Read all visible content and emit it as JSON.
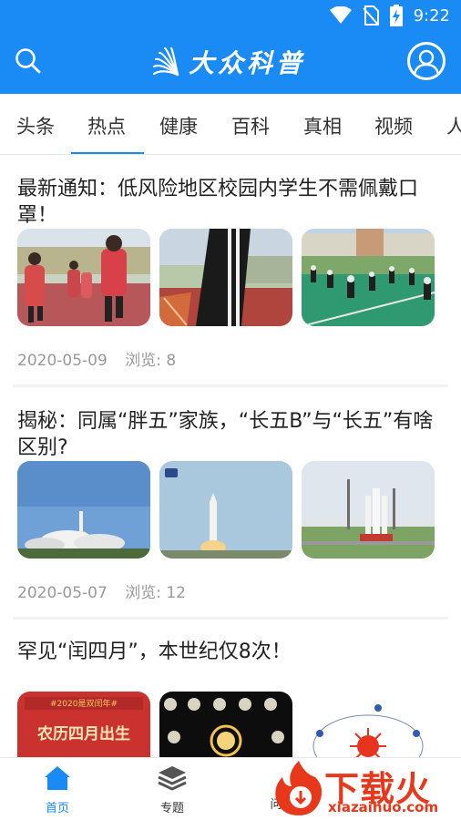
{
  "status_bar": {
    "time": "9:22",
    "icons": [
      "wifi-icon",
      "no-sim-icon",
      "battery-charging-icon"
    ]
  },
  "header": {
    "logo_text": "大众科普",
    "search_icon": "search-icon",
    "profile_icon": "user-avatar-icon",
    "background": "#1a8af5"
  },
  "tabs": [
    {
      "label": "头条"
    },
    {
      "label": "热点",
      "active": true
    },
    {
      "label": "健康"
    },
    {
      "label": "百科"
    },
    {
      "label": "真相"
    },
    {
      "label": "视频"
    },
    {
      "label": "人"
    }
  ],
  "articles": [
    {
      "title": "最新通知：低风险地区校园内学生不需佩戴口罩！",
      "date": "2020-05-09",
      "views_label": "浏览: 8",
      "thumbnails": [
        "students-running-photo",
        "student-running-closeup-photo",
        "students-exercising-court-photo"
      ]
    },
    {
      "title": "揭秘：同属“胖五”家族，“长五B”与“长五”有啥区别?",
      "date": "2020-05-07",
      "views_label": "浏览: 12",
      "thumbnails": [
        "rocket-launch-photo",
        "rocket-liftoff-photo",
        "rocket-on-pad-photo"
      ]
    },
    {
      "title": "罕见“闰四月”，本世纪仅8次！",
      "thumbnails": [
        "lunar-calendar-poster",
        "moon-phases-photo",
        "solar-orbit-diagram"
      ],
      "thumb_text_1": "农历四月出生",
      "thumb_text_1_top": "#2020是双闰年#"
    }
  ],
  "bottom_nav": [
    {
      "label": "首页",
      "icon": "home-icon",
      "active": true
    },
    {
      "label": "专题",
      "icon": "layers-icon"
    },
    {
      "label": "问",
      "icon": "question-icon"
    }
  ],
  "watermark": {
    "main": "下载火",
    "sub": "xiazaihuo.com"
  },
  "colors": {
    "accent": "#1a8af5",
    "watermark": "#e8381c"
  }
}
